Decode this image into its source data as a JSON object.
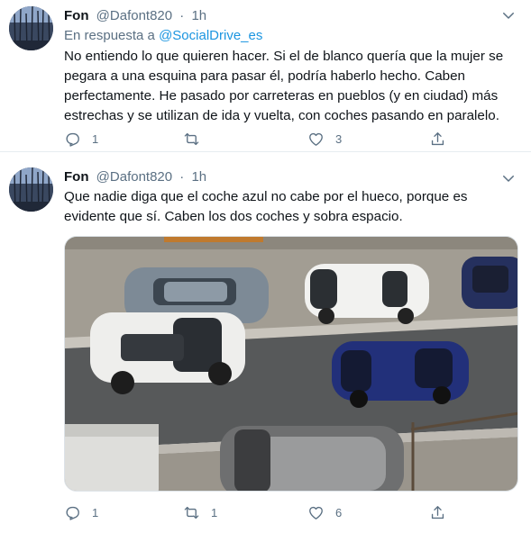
{
  "tweets": [
    {
      "author_name": "Fon",
      "author_handle": "@Dafont820",
      "separator": "·",
      "time": "1h",
      "reply_prefix": "En respuesta a",
      "reply_handle": "@SocialDrive_es",
      "text": "No entiendo lo que quieren hacer. Si el de blanco quería que la mujer se pegara a una esquina para pasar él, podría haberlo hecho. Caben perfectamente. He pasado por carreteras en pueblos (y en ciudad) más estrechas y se utilizan de ida y vuelta, con coches pasando en paralelo.",
      "replies": "1",
      "retweets": "",
      "likes": "3"
    },
    {
      "author_name": "Fon",
      "author_handle": "@Dafont820",
      "separator": "·",
      "time": "1h",
      "text": "Que nadie diga que el coche azul no cabe por el hueco, porque es evidente que sí. Caben los dos coches y sobra espacio.",
      "replies": "1",
      "retweets": "1",
      "likes": "6"
    }
  ],
  "colors": {
    "text": "#0f1419",
    "secondary": "#5b7083",
    "link": "#1b95e0",
    "divider": "#e6ecf0"
  },
  "icons": [
    "chevron-down-icon",
    "reply-icon",
    "retweet-icon",
    "like-icon",
    "share-icon"
  ]
}
